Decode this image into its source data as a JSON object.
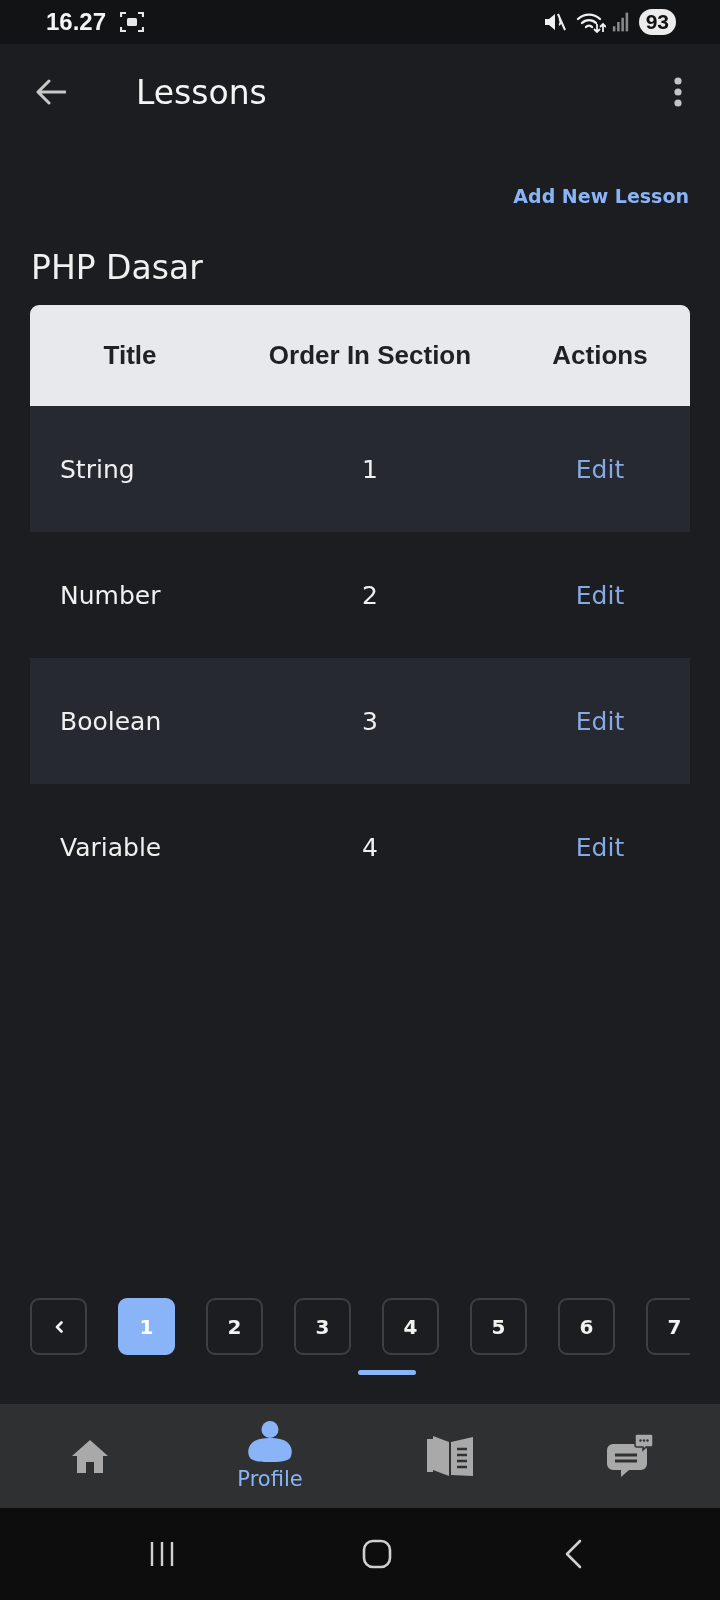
{
  "status_bar": {
    "time": "16.27",
    "battery": "93"
  },
  "app_bar": {
    "title": "Lessons"
  },
  "add_lesson_link": "Add New Lesson",
  "section_title": "PHP Dasar",
  "table": {
    "columns": [
      "Title",
      "Order In Section",
      "Actions"
    ],
    "rows": [
      {
        "title": "String",
        "order": "1",
        "action": "Edit"
      },
      {
        "title": "Number",
        "order": "2",
        "action": "Edit"
      },
      {
        "title": "Boolean",
        "order": "3",
        "action": "Edit"
      },
      {
        "title": "Variable",
        "order": "4",
        "action": "Edit"
      }
    ]
  },
  "pagination": {
    "pages": [
      {
        "label": "1",
        "selected": true
      },
      {
        "label": "2",
        "selected": false
      },
      {
        "label": "3",
        "selected": false
      },
      {
        "label": "4",
        "selected": false
      },
      {
        "label": "5",
        "selected": false
      },
      {
        "label": "6",
        "selected": false
      },
      {
        "label": "7",
        "selected": false
      }
    ]
  },
  "bottom_nav": [
    {
      "selected": false
    },
    {
      "label": "Profile",
      "selected": true
    },
    {
      "selected": false
    },
    {
      "selected": false
    }
  ]
}
